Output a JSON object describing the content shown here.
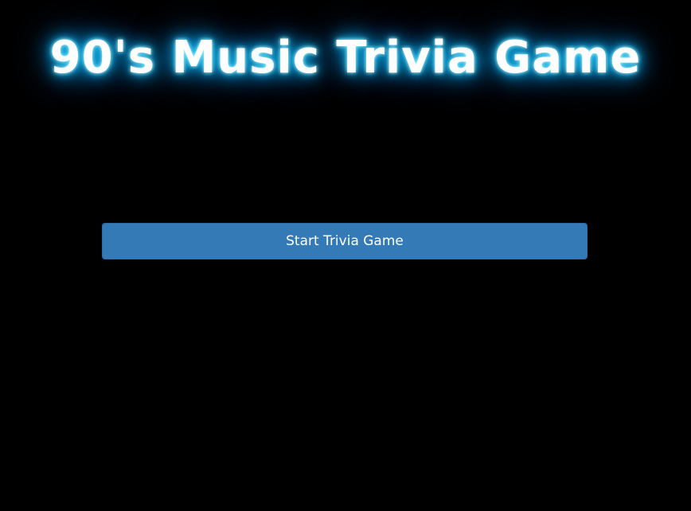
{
  "page": {
    "title": "90's Music Trivia Game"
  },
  "controls": {
    "start_label": "Start Trivia Game"
  },
  "colors": {
    "background": "#000000",
    "title_text": "#ffffff",
    "title_glow": "#00b8ff",
    "button_bg": "#337ab7",
    "button_text": "#ffffff"
  }
}
